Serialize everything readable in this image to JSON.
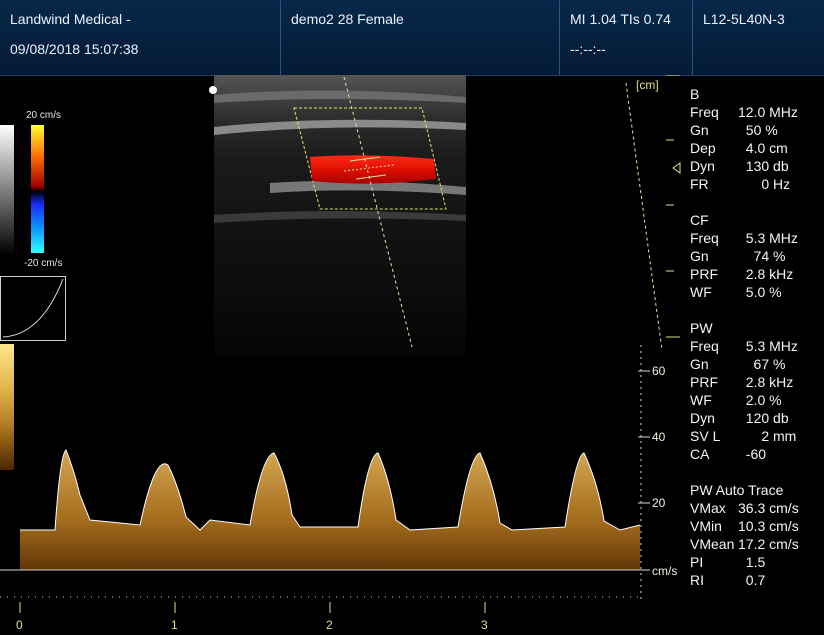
{
  "header": {
    "org_name": "Landwind Medical -",
    "datetime": "09/08/2018 15:07:38",
    "patient": "demo2 28 Female",
    "mi_tis": "MI 1.04 TIs 0.74",
    "mi_tis_sub": "--:--:--",
    "probe": "L12-5L40N-3"
  },
  "color_scale": {
    "top": "20 cm/s",
    "bottom": "-20 cm/s"
  },
  "depth_unit": "[cm]",
  "doppler": {
    "scale_values": [
      "60",
      "40",
      "20"
    ],
    "unit": "cm/s",
    "time_ticks": [
      "0",
      "1",
      "2",
      "3"
    ]
  },
  "params": {
    "b": {
      "title": "B",
      "rows": [
        {
          "label": "Freq",
          "value": "12.0 MHz"
        },
        {
          "label": "Gn",
          "value": "  50 %"
        },
        {
          "label": "Dep",
          "value": "  4.0 cm"
        },
        {
          "label": "Dyn",
          "value": "  130 db"
        },
        {
          "label": "FR",
          "value": "      0 Hz"
        }
      ]
    },
    "cf": {
      "title": "CF",
      "rows": [
        {
          "label": "Freq",
          "value": "  5.3 MHz"
        },
        {
          "label": "Gn",
          "value": "    74 %"
        },
        {
          "label": "PRF",
          "value": "  2.8 kHz"
        },
        {
          "label": "WF",
          "value": "  5.0 %"
        }
      ]
    },
    "pw": {
      "title": "PW",
      "rows": [
        {
          "label": "Freq",
          "value": "  5.3 MHz"
        },
        {
          "label": "Gn",
          "value": "    67 %"
        },
        {
          "label": "PRF",
          "value": "  2.8 kHz"
        },
        {
          "label": "WF",
          "value": "  2.0 %"
        },
        {
          "label": "Dyn",
          "value": "  120 db"
        },
        {
          "label": "SV L",
          "value": "      2 mm"
        },
        {
          "label": "CA",
          "value": "  -60"
        }
      ]
    },
    "trace": {
      "title": "PW Auto Trace",
      "rows": [
        {
          "label": "VMax",
          "value": "36.3 cm/s"
        },
        {
          "label": "VMin",
          "value": "10.3 cm/s"
        },
        {
          "label": "VMean",
          "value": "17.2 cm/s"
        },
        {
          "label": "PI",
          "value": "  1.5"
        },
        {
          "label": "RI",
          "value": "  0.7"
        }
      ]
    }
  }
}
